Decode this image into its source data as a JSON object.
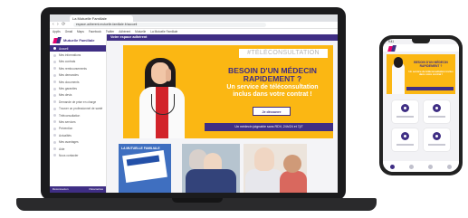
{
  "browser": {
    "tab_title": "La Mutuelle Familiale",
    "url": "espace-adherent.mutuelle-familiale.fr/accueil",
    "bookmarks": [
      "Applis",
      "Gmail",
      "Maps",
      "Facebook",
      "Twitter",
      "Adhérent",
      "Mutuelle",
      "La Mutuelle Familiale"
    ]
  },
  "app": {
    "logo_text": "Mutuelle Familiale",
    "header_title": "Votre espace adhérent",
    "menu": [
      "Accueil",
      "Mes informations",
      "Mes contrats",
      "Mes remboursements",
      "Mes demandes",
      "Mes documents",
      "Mes garanties",
      "Mes devis",
      "Demande de prise en charge",
      "Trouver un professionnel de santé",
      "Téléconsultation",
      "Mes services",
      "Prévention",
      "Actualités",
      "Mes avantages",
      "Aide",
      "Nous contacter"
    ],
    "footer_left": "Déconnexion",
    "footer_right": "Paramètres"
  },
  "banner": {
    "tag": "#TÉLÉCONSULTATION",
    "title_line1": "BESOIN D'UN MÉDECIN",
    "title_line2": "RAPIDEMENT ?",
    "subtitle_line1": "Un service de téléconsultation",
    "subtitle_line2": "inclus dans votre contrat !",
    "cta": "Je découvre",
    "strip": "Un médecin joignable sans RDV, 24h/24 et 7j/7"
  },
  "cards": {
    "card1_logo": "LA MUTUELLE FAMILIALE"
  },
  "phone": {
    "time": "9:41",
    "banner_title": "BESOIN D'UN MÉDECIN RAPIDEMENT ?",
    "banner_sub": "Un service de téléconsultation inclus dans votre contrat !"
  },
  "colors": {
    "brand_purple": "#3f2e84",
    "brand_pink": "#e5006d",
    "banner_yellow": "#fbb713"
  }
}
